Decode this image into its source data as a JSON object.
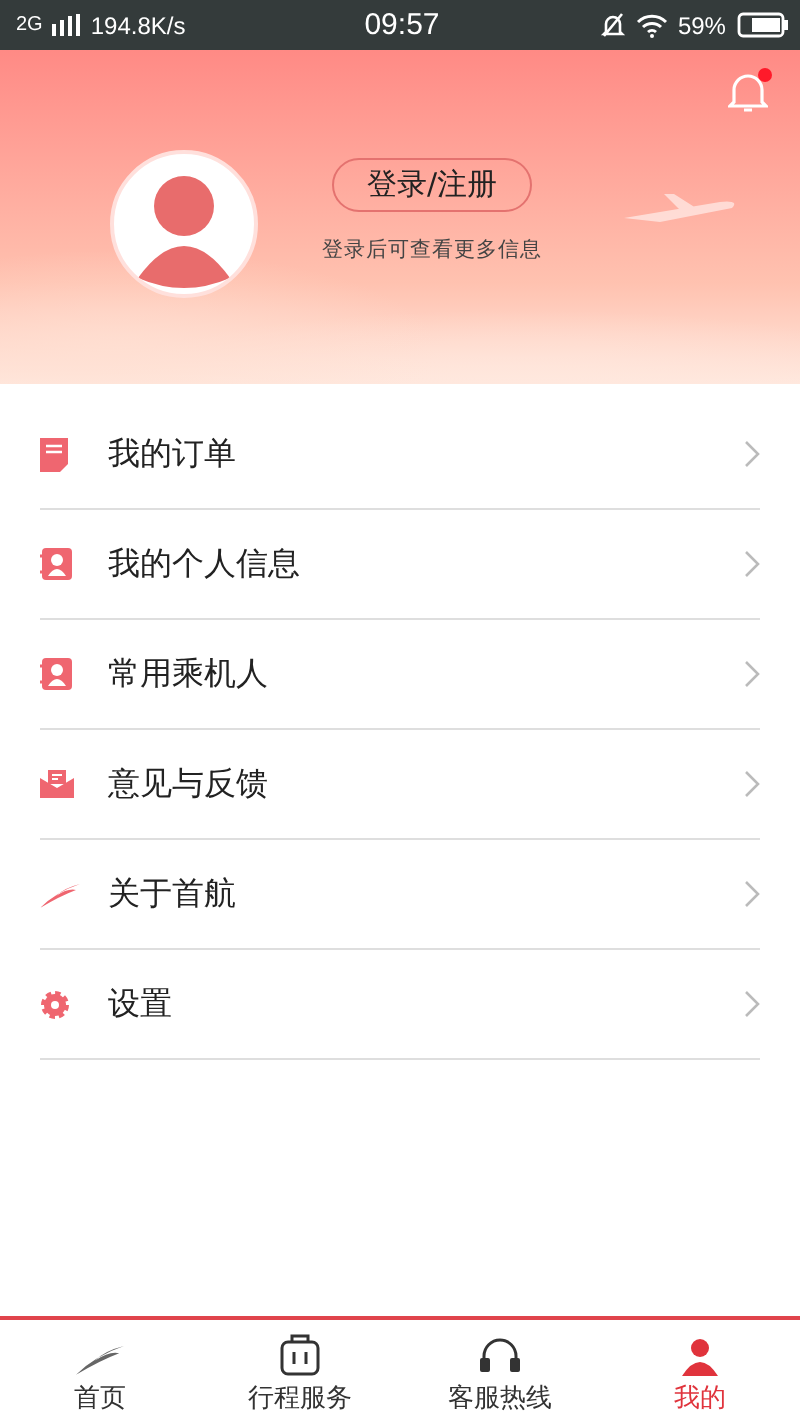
{
  "status_bar": {
    "network": "2G",
    "speed": "194.8K/s",
    "time": "09:57",
    "battery": "59%"
  },
  "header": {
    "notification_unread": true,
    "login_button": "登录/注册",
    "hint": "登录后可查看更多信息"
  },
  "menu": [
    {
      "kind": "order",
      "label": "我的订单"
    },
    {
      "kind": "person",
      "label": "我的个人信息"
    },
    {
      "kind": "person",
      "label": "常用乘机人"
    },
    {
      "kind": "mail",
      "label": "意见与反馈"
    },
    {
      "kind": "logo",
      "label": "关于首航"
    },
    {
      "kind": "gear",
      "label": "设置"
    }
  ],
  "tabs": [
    {
      "kind": "logo",
      "label": "首页",
      "selected": false
    },
    {
      "kind": "bag",
      "label": "行程服务",
      "selected": false
    },
    {
      "kind": "headset",
      "label": "客服热线",
      "selected": false
    },
    {
      "kind": "person",
      "label": "我的",
      "selected": true
    }
  ]
}
